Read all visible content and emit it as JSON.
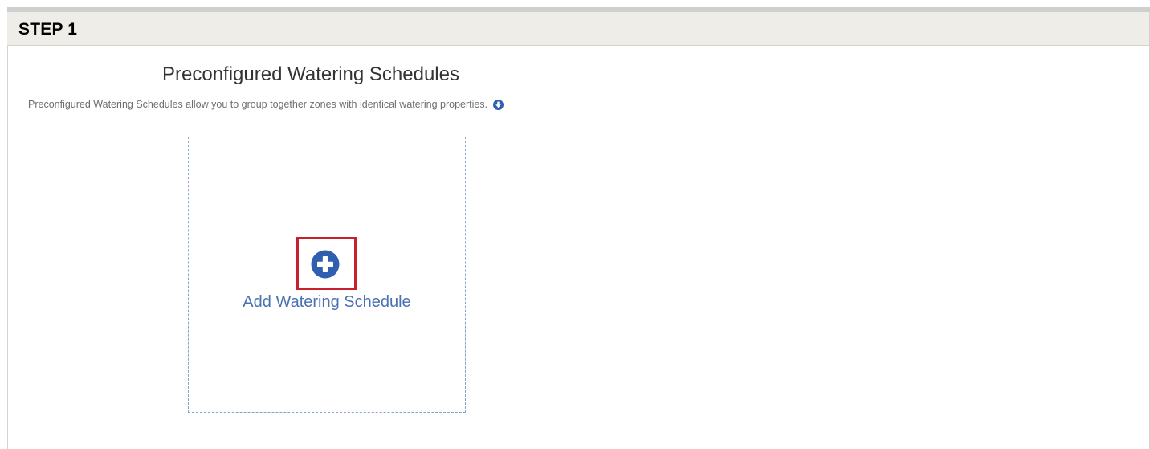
{
  "step": {
    "title": "STEP 1"
  },
  "section": {
    "title": "Preconfigured Watering Schedules",
    "description": "Preconfigured Watering Schedules allow you to group together zones with identical watering properties.",
    "info_icon": "circle-arrow-down-icon"
  },
  "add_card": {
    "label": "Add Watering Schedule",
    "icon": "plus-circle-icon"
  },
  "colors": {
    "accent_blue": "#2f5fae",
    "link_blue": "#4a72b0",
    "highlight_red": "#c8202f",
    "header_bg": "#efede8"
  }
}
